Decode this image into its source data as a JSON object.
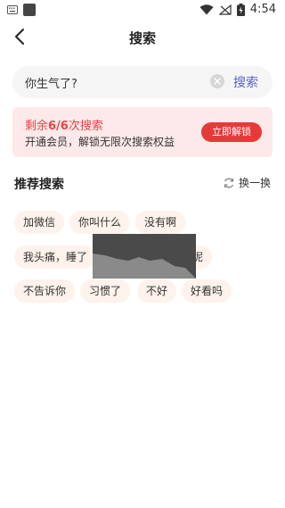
{
  "status_bar": {
    "time": "4:54"
  },
  "nav": {
    "title": "搜索"
  },
  "search": {
    "query": "你生气了?",
    "button_label": "搜索"
  },
  "vip": {
    "remaining_prefix": "剩余",
    "remaining_count": "6/6",
    "remaining_suffix": "次搜索",
    "description": "开通会员，解锁无限次搜索权益",
    "unlock_label": "立即解锁"
  },
  "recommend": {
    "title": "推荐搜索",
    "refresh_label": "换一换",
    "tags": [
      "加微信",
      "你叫什么",
      "没有啊",
      "我头痛，睡了",
      "呢",
      "不告诉你",
      "习惯了",
      "不好",
      "好看吗"
    ]
  },
  "colors": {
    "accent_red": "#e63a3a",
    "link_blue": "#5a63c9",
    "card_bg": "#fde9e9",
    "tag_bg": "#fdf2ec"
  }
}
